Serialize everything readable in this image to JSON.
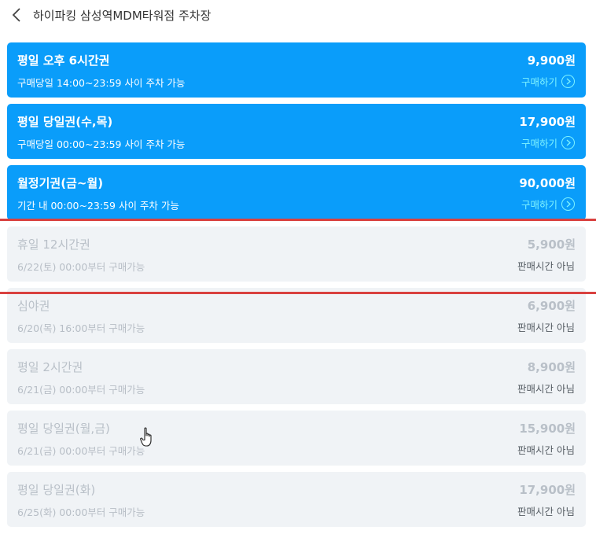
{
  "header": {
    "title": "하이파킹 삼성역MDM타워점 주차장"
  },
  "colors": {
    "active_card": "#0a9dfa",
    "inactive_card": "#f0f3f6",
    "action_text": "#7ff3ff",
    "annotation_line": "#d9413f"
  },
  "tickets": [
    {
      "name": "평일 오후 6시간권",
      "sub": "구매당일 14:00~23:59 사이 주차 가능",
      "price": "9,900원",
      "action": "구매하기",
      "active": true
    },
    {
      "name": "평일 당일권(수,목)",
      "sub": "구매당일 00:00~23:59 사이 주차 가능",
      "price": "17,900원",
      "action": "구매하기",
      "active": true
    },
    {
      "name": "월정기권(금~월)",
      "sub": "기간 내 00:00~23:59 사이 주차 가능",
      "price": "90,000원",
      "action": "구매하기",
      "active": true
    },
    {
      "name": "휴일 12시간권",
      "sub": "6/22(토) 00:00부터 구매가능",
      "price": "5,900원",
      "action": "판매시간 아님",
      "active": false
    },
    {
      "name": "심야권",
      "sub": "6/20(목) 16:00부터 구매가능",
      "price": "6,900원",
      "action": "판매시간 아님",
      "active": false
    },
    {
      "name": "평일 2시간권",
      "sub": "6/21(금) 00:00부터 구매가능",
      "price": "8,900원",
      "action": "판매시간 아님",
      "active": false
    },
    {
      "name": "평일 당일권(월,금)",
      "sub": "6/21(금) 00:00부터 구매가능",
      "price": "15,900원",
      "action": "판매시간 아님",
      "active": false
    },
    {
      "name": "평일 당일권(화)",
      "sub": "6/25(화) 00:00부터 구매가능",
      "price": "17,900원",
      "action": "판매시간 아님",
      "active": false
    }
  ]
}
